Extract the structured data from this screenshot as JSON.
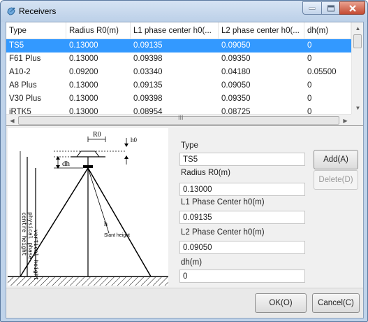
{
  "window": {
    "title": "Receivers",
    "icon": "satellite-dish-icon"
  },
  "table": {
    "columns": [
      "Type",
      "Radius R0(m)",
      "L1 phase center h0(...",
      "L2 phase center h0(...",
      "dh(m)"
    ],
    "rows": [
      {
        "type": "TS5",
        "radius": "0.13000",
        "l1": "0.09135",
        "l2": "0.09050",
        "dh": "0",
        "selected": true
      },
      {
        "type": "F61 Plus",
        "radius": "0.13000",
        "l1": "0.09398",
        "l2": "0.09350",
        "dh": "0"
      },
      {
        "type": "A10-2",
        "radius": "0.09200",
        "l1": "0.03340",
        "l2": "0.04180",
        "dh": "0.05500"
      },
      {
        "type": "A8 Plus",
        "radius": "0.13000",
        "l1": "0.09135",
        "l2": "0.09050",
        "dh": "0"
      },
      {
        "type": "V30 Plus",
        "radius": "0.13000",
        "l1": "0.09398",
        "l2": "0.09350",
        "dh": "0"
      },
      {
        "type": "iRTK5",
        "radius": "0.13000",
        "l1": "0.08954",
        "l2": "0.08725",
        "dh": "0"
      }
    ],
    "hscroll_grip": "III"
  },
  "diagram": {
    "label_r0": "R0",
    "label_h0": "h0",
    "label_dh": "dh",
    "label_h": "h",
    "label_slant": "Slant height",
    "label_vertical": "vertical height",
    "label_physical": "physical phase-",
    "label_center": "centre height"
  },
  "form": {
    "type_label": "Type",
    "type_value": "TS5",
    "radius_label": "Radius R0(m)",
    "radius_value": "0.13000",
    "l1_label": "L1 Phase Center h0(m)",
    "l1_value": "0.09135",
    "l2_label": "L2 Phase Center h0(m)",
    "l2_value": "0.09050",
    "dh_label": "dh(m)",
    "dh_value": "0"
  },
  "buttons": {
    "add": "Add(A)",
    "delete": "Delete(D)",
    "ok": "OK(O)",
    "cancel": "Cancel(C)"
  },
  "colors": {
    "selection": "#3399ff",
    "titlebar": "#bfd3ea",
    "close": "#c44b32"
  }
}
